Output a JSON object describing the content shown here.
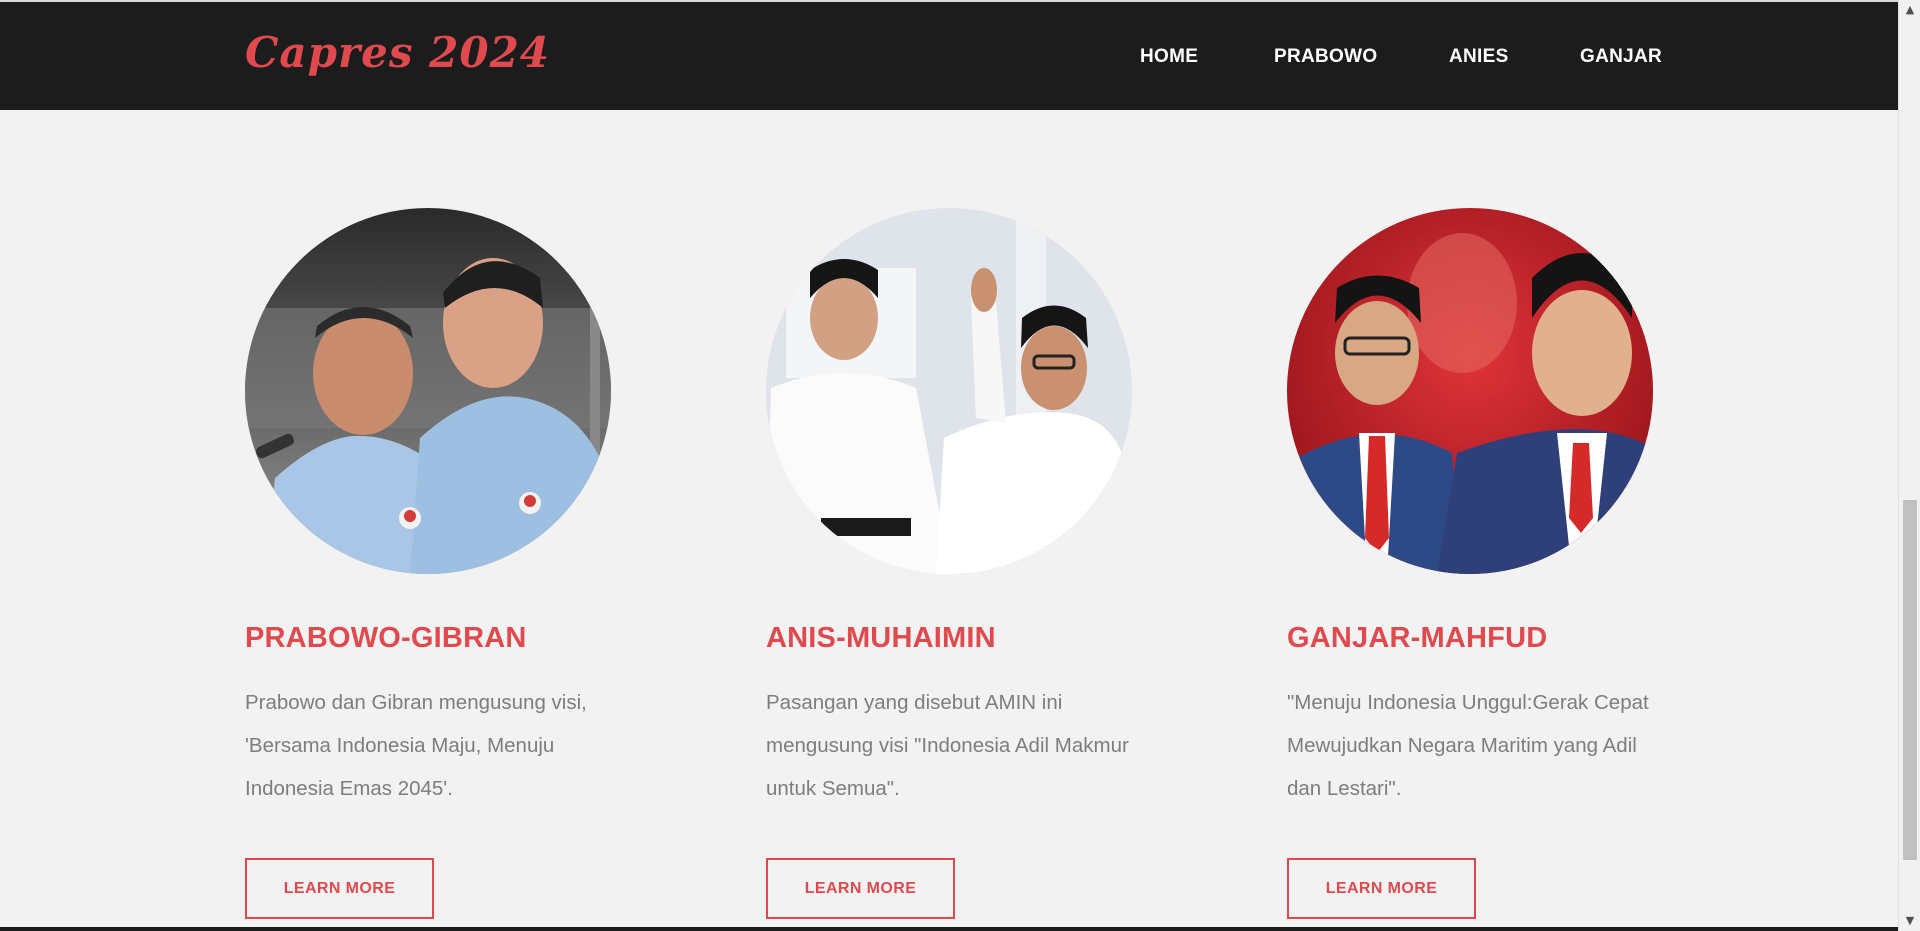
{
  "brand": {
    "logo_text": "Capres 2024"
  },
  "nav": {
    "items": [
      {
        "label": "HOME"
      },
      {
        "label": "PRABOWO"
      },
      {
        "label": "ANIES"
      },
      {
        "label": "GANJAR"
      }
    ]
  },
  "colors": {
    "accent": "#e04a4f",
    "navbar_bg": "#1c1c1c",
    "page_bg": "#f2f2f2",
    "body_text": "#7d7d7d"
  },
  "cards": [
    {
      "title": "PRABOWO-GIBRAN",
      "description": "Prabowo dan Gibran mengusung visi, 'Bersama Indonesia Maju, Menuju Indonesia Emas 2045'.",
      "button_label": "LEARN MORE"
    },
    {
      "title": "ANIS-MUHAIMIN",
      "description": "Pasangan yang disebut AMIN ini mengusung visi \"Indonesia Adil Makmur untuk Semua\".",
      "button_label": "LEARN MORE"
    },
    {
      "title": "GANJAR-MAHFUD",
      "description": "\"Menuju Indonesia Unggul:Gerak Cepat Mewujudkan Negara Maritim yang Adil dan Lestari\".",
      "button_label": "LEARN MORE"
    }
  ]
}
